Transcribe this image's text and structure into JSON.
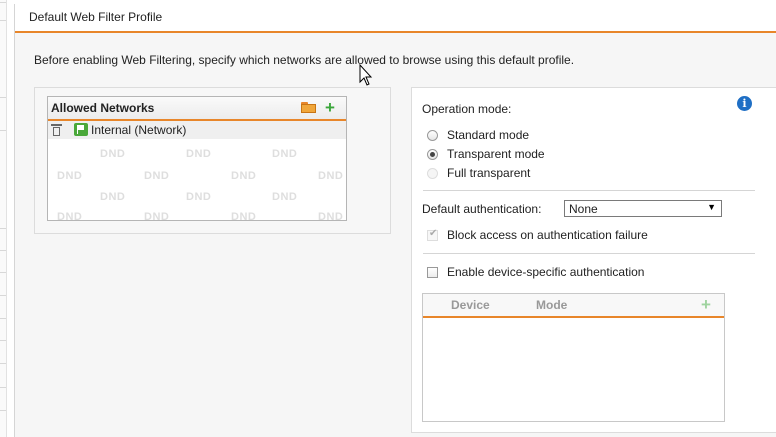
{
  "panel": {
    "title": "Default Web Filter Profile",
    "intro": "Before enabling Web Filtering, specify which networks are allowed to browse using this default profile."
  },
  "allowed_networks": {
    "title": "Allowed Networks",
    "rows": [
      {
        "label": "Internal (Network)"
      }
    ],
    "watermark": "DND"
  },
  "operation_mode": {
    "label": "Operation mode:",
    "options": [
      {
        "label": "Standard mode",
        "selected": false,
        "disabled": false
      },
      {
        "label": "Transparent mode",
        "selected": true,
        "disabled": false
      },
      {
        "label": "Full transparent",
        "selected": false,
        "disabled": true
      }
    ]
  },
  "authentication": {
    "label": "Default authentication:",
    "selected": "None",
    "block_access_label": "Block access on authentication failure",
    "block_access_checked": true,
    "block_access_disabled": true
  },
  "device_auth": {
    "label": "Enable device-specific authentication",
    "checked": false,
    "columns": [
      "Device",
      "Mode"
    ]
  },
  "colors": {
    "accent": "#e8862a",
    "add": "#3aa63a",
    "info": "#1f6fc5"
  },
  "icons": [
    "folder-icon",
    "plus-icon",
    "trash-icon",
    "network-icon",
    "info-icon",
    "chevron-down-icon",
    "cursor-icon"
  ]
}
